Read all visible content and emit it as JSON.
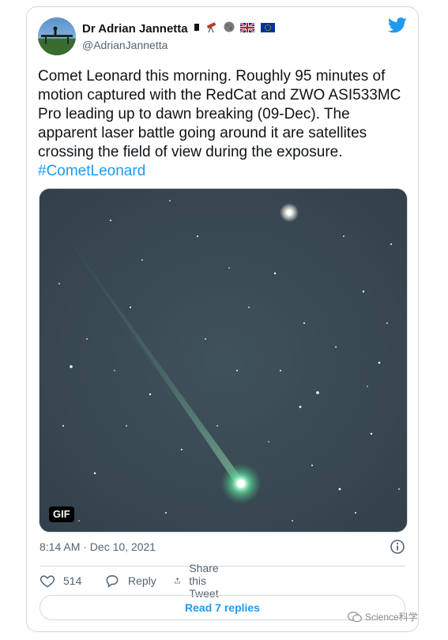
{
  "author": {
    "display_name": "Dr Adrian Jannetta",
    "handle": "@AdrianJannetta",
    "emoji_names": [
      "black-flag-emoji",
      "telescope-emoji",
      "moon-emoji",
      "uk-flag-emoji",
      "eu-flag-emoji"
    ]
  },
  "tweet": {
    "text": "Comet Leonard this morning.  Roughly 95 minutes of motion captured with the RedCat and ZWO ASI533MC Pro leading up to dawn breaking (09-Dec).  The apparent laser battle going around it are satellites crossing the field of view during the exposure. ",
    "hashtag": "#CometLeonard",
    "media_badge": "GIF",
    "timestamp": "8:14 AM · Dec 10, 2021"
  },
  "actions": {
    "like_count": "514",
    "reply_label": "Reply",
    "share_label": "Share this Tweet",
    "read_replies_label": "Read 7 replies"
  },
  "watermark": {
    "text": "Science科学"
  },
  "colors": {
    "brand_blue": "#1d9bf0",
    "text_primary": "#0f1419",
    "text_secondary": "#536471",
    "border": "#cfd9de",
    "sky": "#3a4a55",
    "comet_green": "#7fe8b0"
  },
  "icons": {
    "brand": "twitter-bird-icon",
    "like": "heart-icon",
    "reply": "reply-bubble-icon",
    "share": "share-icon",
    "info": "info-icon",
    "watermark": "wechat-icon"
  }
}
